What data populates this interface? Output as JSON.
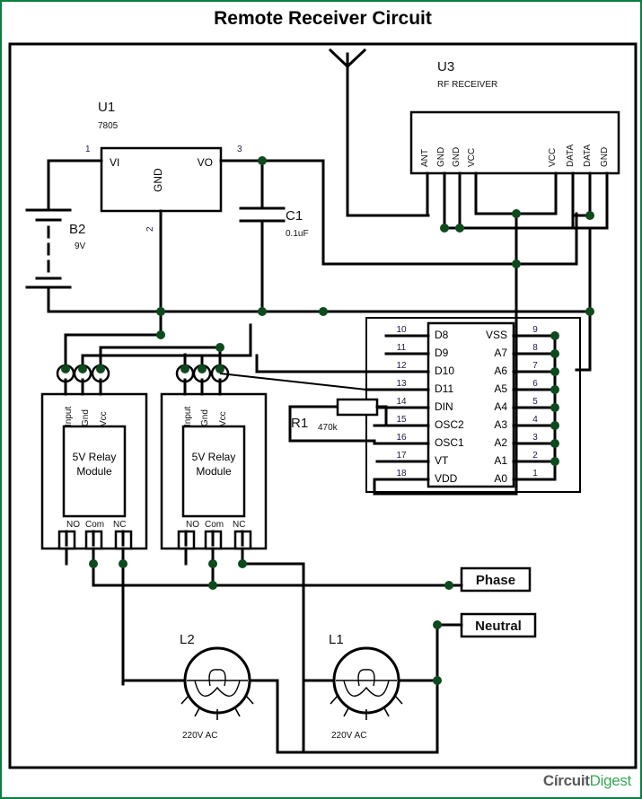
{
  "page": {
    "title": "Remote Receiver Circuit"
  },
  "logo": {
    "word1": "Círcuit",
    "word2": "Digest"
  },
  "regulator": {
    "ref": "U1",
    "part": "7805",
    "pin_in_label": "VI",
    "pin_out_label": "VO",
    "pin_gnd_label": "GND",
    "pin_in_num": "1",
    "pin_gnd_num": "2",
    "pin_out_num": "3"
  },
  "battery": {
    "ref": "B2",
    "value": "9V"
  },
  "capacitor": {
    "ref": "C1",
    "value": "0.1uF"
  },
  "resistor": {
    "ref": "R1",
    "value": "470k"
  },
  "antenna": {
    "name": "antenna"
  },
  "rf_receiver": {
    "ref": "U3",
    "subtitle": "RF RECEIVER",
    "left_pins": [
      "ANT",
      "GND",
      "GND",
      "VCC"
    ],
    "right_pins": [
      "VCC",
      "DATA",
      "DATA",
      "GND"
    ]
  },
  "decoder": {
    "left_pins": [
      {
        "num": "10",
        "name": "D8"
      },
      {
        "num": "11",
        "name": "D9"
      },
      {
        "num": "12",
        "name": "D10"
      },
      {
        "num": "13",
        "name": "D11"
      },
      {
        "num": "14",
        "name": "DIN"
      },
      {
        "num": "15",
        "name": "OSC2"
      },
      {
        "num": "16",
        "name": "OSC1"
      },
      {
        "num": "17",
        "name": "VT"
      },
      {
        "num": "18",
        "name": "VDD"
      }
    ],
    "right_pins": [
      {
        "num": "9",
        "name": "VSS"
      },
      {
        "num": "8",
        "name": "A7"
      },
      {
        "num": "7",
        "name": "A6"
      },
      {
        "num": "6",
        "name": "A5"
      },
      {
        "num": "5",
        "name": "A4"
      },
      {
        "num": "4",
        "name": "A3"
      },
      {
        "num": "3",
        "name": "A2"
      },
      {
        "num": "2",
        "name": "A1"
      },
      {
        "num": "1",
        "name": "A0"
      }
    ]
  },
  "relay1": {
    "title_line1": "5V Relay",
    "title_line2": "Module",
    "top_pins": [
      "Input",
      "Gnd",
      "Vcc"
    ],
    "bottom_pins": [
      "NO",
      "Com",
      "NC"
    ]
  },
  "relay2": {
    "title_line1": "5V Relay",
    "title_line2": "Module",
    "top_pins": [
      "Input",
      "Gnd",
      "Vcc"
    ],
    "bottom_pins": [
      "NO",
      "Com",
      "NC"
    ]
  },
  "mains": {
    "phase": "Phase",
    "neutral": "Neutral"
  },
  "lamp1": {
    "ref": "L1",
    "rating": "220V AC"
  },
  "lamp2": {
    "ref": "L2",
    "rating": "220V AC"
  },
  "colors": {
    "border_green": "#0a7f3f",
    "junction_dot": "#0d4a1e",
    "wire": "#000000",
    "logo_green": "#35a853",
    "logo_gray": "#58595b"
  }
}
